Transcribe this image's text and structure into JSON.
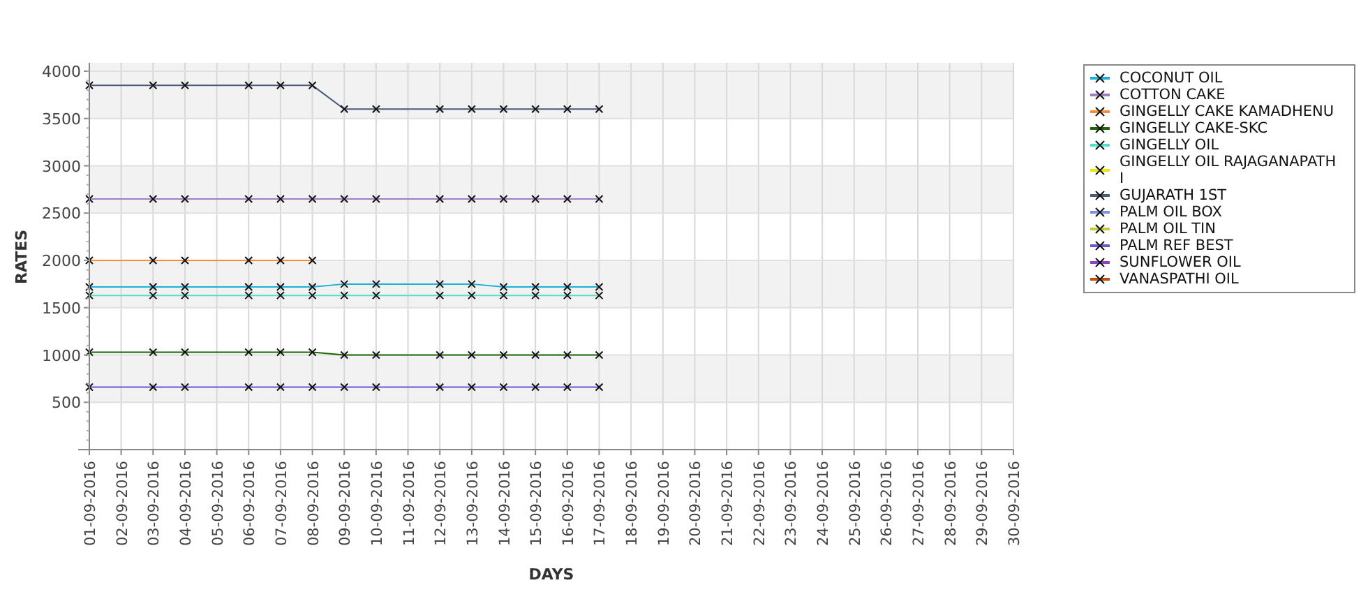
{
  "chart_data": {
    "type": "line",
    "xlabel": "DAYS",
    "ylabel": "RATES",
    "categories": [
      "01-09-2016",
      "02-09-2016",
      "03-09-2016",
      "04-09-2016",
      "05-09-2016",
      "06-09-2016",
      "07-09-2016",
      "08-09-2016",
      "09-09-2016",
      "10-09-2016",
      "11-09-2016",
      "12-09-2016",
      "13-09-2016",
      "14-09-2016",
      "15-09-2016",
      "16-09-2016",
      "17-09-2016",
      "18-09-2016",
      "19-09-2016",
      "20-09-2016",
      "21-09-2016",
      "22-09-2016",
      "23-09-2016",
      "24-09-2016",
      "25-09-2016",
      "26-09-2016",
      "27-09-2016",
      "28-09-2016",
      "29-09-2016",
      "30-09-2016"
    ],
    "ylim": [
      0,
      4000
    ],
    "grid": true,
    "yticks": [
      500,
      1000,
      1500,
      2000,
      2500,
      3000,
      3500,
      4000
    ],
    "series": [
      {
        "name": "COCONUT OIL",
        "color": "#1ab0d8",
        "marker": "x",
        "values": [
          1720,
          null,
          1720,
          1720,
          null,
          1720,
          1720,
          1720,
          1750,
          1750,
          null,
          1750,
          1750,
          1720,
          1720,
          1720,
          1720,
          null,
          null,
          null,
          null,
          null,
          null,
          null,
          null,
          null,
          null,
          null,
          null,
          null
        ]
      },
      {
        "name": "COTTON CAKE",
        "color": "#a07ec0",
        "marker": "x",
        "values": [
          2650,
          null,
          2650,
          2650,
          null,
          2650,
          2650,
          2650,
          2650,
          2650,
          null,
          2650,
          2650,
          2650,
          2650,
          2650,
          2650,
          null,
          null,
          null,
          null,
          null,
          null,
          null,
          null,
          null,
          null,
          null,
          null,
          null
        ]
      },
      {
        "name": "GINGELLY CAKE KAMADHENU",
        "color": "#ff8c2a",
        "marker": "x",
        "values": [
          2000,
          null,
          2000,
          2000,
          null,
          2000,
          2000,
          2000,
          null,
          null,
          null,
          null,
          null,
          null,
          null,
          null,
          null,
          null,
          null,
          null,
          null,
          null,
          null,
          null,
          null,
          null,
          null,
          null,
          null,
          null
        ]
      },
      {
        "name": "GINGELLY CAKE-SKC",
        "color": "#1a6600",
        "marker": "x",
        "values": [
          1030,
          null,
          1030,
          1030,
          null,
          1030,
          1030,
          1030,
          1000,
          1000,
          null,
          1000,
          1000,
          1000,
          1000,
          1000,
          1000,
          null,
          null,
          null,
          null,
          null,
          null,
          null,
          null,
          null,
          null,
          null,
          null,
          null
        ]
      },
      {
        "name": "GINGELLY OIL",
        "color": "#50e0c8",
        "marker": "x",
        "values": [
          1630,
          null,
          1630,
          1630,
          null,
          1630,
          1630,
          1630,
          1630,
          1630,
          null,
          1630,
          1630,
          1630,
          1630,
          1630,
          1630,
          null,
          null,
          null,
          null,
          null,
          null,
          null,
          null,
          null,
          null,
          null,
          null,
          null
        ]
      },
      {
        "name": "GINGELLY OIL RAJAGANAPATHI",
        "color": "#e8e800",
        "marker": "x",
        "values": [
          null,
          null,
          null,
          null,
          null,
          null,
          null,
          null,
          null,
          null,
          null,
          null,
          null,
          null,
          null,
          null,
          null,
          null,
          null,
          null,
          null,
          null,
          null,
          null,
          null,
          null,
          null,
          null,
          null,
          null
        ]
      },
      {
        "name": "GUJARATH 1ST",
        "color": "#4a5a78",
        "marker": "x",
        "values": [
          3850,
          null,
          3850,
          3850,
          null,
          3850,
          3850,
          3850,
          3600,
          3600,
          null,
          3600,
          3600,
          3600,
          3600,
          3600,
          3600,
          null,
          null,
          null,
          null,
          null,
          null,
          null,
          null,
          null,
          null,
          null,
          null,
          null
        ]
      },
      {
        "name": "PALM OIL BOX",
        "color": "#8090e8",
        "marker": "x",
        "values": [
          null,
          null,
          null,
          null,
          null,
          null,
          null,
          null,
          null,
          null,
          null,
          null,
          null,
          null,
          null,
          null,
          null,
          null,
          null,
          null,
          null,
          null,
          null,
          null,
          null,
          null,
          null,
          null,
          null,
          null
        ]
      },
      {
        "name": "PALM OIL TIN",
        "color": "#c8c830",
        "marker": "x",
        "values": [
          null,
          null,
          null,
          null,
          null,
          null,
          null,
          null,
          null,
          null,
          null,
          null,
          null,
          null,
          null,
          null,
          null,
          null,
          null,
          null,
          null,
          null,
          null,
          null,
          null,
          null,
          null,
          null,
          null,
          null
        ]
      },
      {
        "name": "PALM REF BEST",
        "color": "#7050d8",
        "marker": "x",
        "values": [
          660,
          null,
          660,
          660,
          null,
          660,
          660,
          660,
          660,
          660,
          null,
          660,
          660,
          660,
          660,
          660,
          660,
          null,
          null,
          null,
          null,
          null,
          null,
          null,
          null,
          null,
          null,
          null,
          null,
          null
        ]
      },
      {
        "name": "SUNFLOWER OIL",
        "color": "#9040d0",
        "marker": "x",
        "values": [
          null,
          null,
          null,
          null,
          null,
          null,
          null,
          null,
          null,
          null,
          null,
          null,
          null,
          null,
          null,
          null,
          null,
          null,
          null,
          null,
          null,
          null,
          null,
          null,
          null,
          null,
          null,
          null,
          null,
          null
        ]
      },
      {
        "name": "VANASPATHI OIL",
        "color": "#c05000",
        "marker": "x",
        "values": [
          null,
          null,
          null,
          null,
          null,
          null,
          null,
          null,
          null,
          null,
          null,
          null,
          null,
          null,
          null,
          null,
          null,
          null,
          null,
          null,
          null,
          null,
          null,
          null,
          null,
          null,
          null,
          null,
          null,
          null
        ]
      }
    ]
  }
}
